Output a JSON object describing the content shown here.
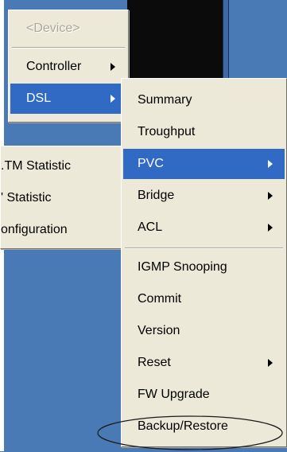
{
  "main_menu": {
    "items": [
      {
        "label": "<Device>",
        "disabled": true,
        "has_submenu": false
      },
      {
        "label": "Controller",
        "has_submenu": true
      },
      {
        "label": "DSL",
        "selected": true,
        "has_submenu": true
      }
    ]
  },
  "side_menu": {
    "items": [
      {
        "label": ".TM Statistic"
      },
      {
        "label": "' Statistic"
      },
      {
        "label": "onfiguration"
      }
    ]
  },
  "sub_menu": {
    "items": [
      {
        "label": "Summary"
      },
      {
        "label": "Troughput"
      },
      {
        "label": "PVC",
        "selected": true,
        "has_submenu": true
      },
      {
        "label": "Bridge",
        "has_submenu": true
      },
      {
        "label": "ACL",
        "has_submenu": true
      },
      {
        "label": "IGMP Snooping"
      },
      {
        "label": "Commit"
      },
      {
        "label": "Version"
      },
      {
        "label": "Reset",
        "has_submenu": true
      },
      {
        "label": "FW Upgrade"
      },
      {
        "label": "Backup/Restore",
        "highlighted_by_annotation": true
      }
    ]
  },
  "colors": {
    "menu_bg": "#ece9d8",
    "selection": "#316ac5",
    "desktop": "#4a7ab5",
    "disabled_text": "#aca899"
  }
}
